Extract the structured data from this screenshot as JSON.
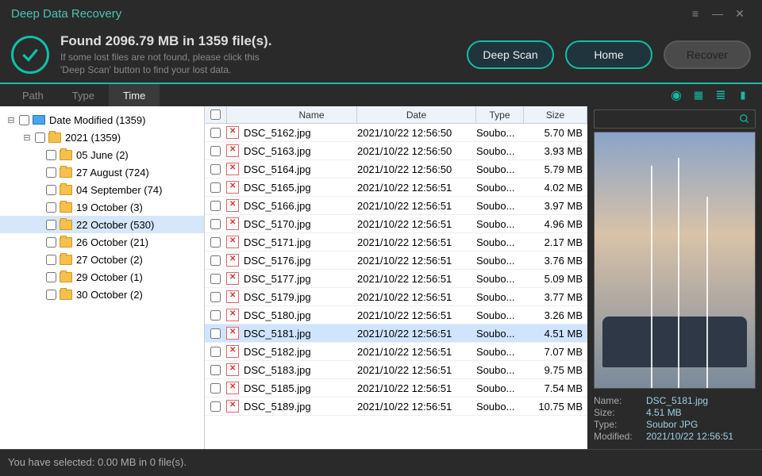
{
  "window": {
    "title": "Deep Data Recovery"
  },
  "header": {
    "found_line": "Found 2096.79 MB in 1359 file(s).",
    "hint_l1": "If some lost files are not found, please click this",
    "hint_l2": "'Deep Scan' button to find your lost data.",
    "btn_deep_scan": "Deep Scan",
    "btn_home": "Home",
    "btn_recover": "Recover"
  },
  "tabs": {
    "path": "Path",
    "type": "Type",
    "time": "Time"
  },
  "tree": {
    "root": "Date Modified (1359)",
    "y2021": "2021 (1359)",
    "nodes": [
      "05 June (2)",
      "27 August (724)",
      "04 September (74)",
      "19 October (3)",
      "22 October (530)",
      "26 October (21)",
      "27 October (2)",
      "29 October (1)",
      "30 October (2)"
    ]
  },
  "columns": {
    "name": "Name",
    "date": "Date",
    "type": "Type",
    "size": "Size"
  },
  "rows": [
    {
      "name": "DSC_5162.jpg",
      "date": "2021/10/22 12:56:50",
      "type": "Soubo...",
      "size": "5.70 MB"
    },
    {
      "name": "DSC_5163.jpg",
      "date": "2021/10/22 12:56:50",
      "type": "Soubo...",
      "size": "3.93 MB"
    },
    {
      "name": "DSC_5164.jpg",
      "date": "2021/10/22 12:56:50",
      "type": "Soubo...",
      "size": "5.79 MB"
    },
    {
      "name": "DSC_5165.jpg",
      "date": "2021/10/22 12:56:51",
      "type": "Soubo...",
      "size": "4.02 MB"
    },
    {
      "name": "DSC_5166.jpg",
      "date": "2021/10/22 12:56:51",
      "type": "Soubo...",
      "size": "3.97 MB"
    },
    {
      "name": "DSC_5170.jpg",
      "date": "2021/10/22 12:56:51",
      "type": "Soubo...",
      "size": "4.96 MB"
    },
    {
      "name": "DSC_5171.jpg",
      "date": "2021/10/22 12:56:51",
      "type": "Soubo...",
      "size": "2.17 MB"
    },
    {
      "name": "DSC_5176.jpg",
      "date": "2021/10/22 12:56:51",
      "type": "Soubo...",
      "size": "3.76 MB"
    },
    {
      "name": "DSC_5177.jpg",
      "date": "2021/10/22 12:56:51",
      "type": "Soubo...",
      "size": "5.09 MB"
    },
    {
      "name": "DSC_5179.jpg",
      "date": "2021/10/22 12:56:51",
      "type": "Soubo...",
      "size": "3.77 MB"
    },
    {
      "name": "DSC_5180.jpg",
      "date": "2021/10/22 12:56:51",
      "type": "Soubo...",
      "size": "3.26 MB"
    },
    {
      "name": "DSC_5181.jpg",
      "date": "2021/10/22 12:56:51",
      "type": "Soubo...",
      "size": "4.51 MB",
      "selected": true
    },
    {
      "name": "DSC_5182.jpg",
      "date": "2021/10/22 12:56:51",
      "type": "Soubo...",
      "size": "7.07 MB"
    },
    {
      "name": "DSC_5183.jpg",
      "date": "2021/10/22 12:56:51",
      "type": "Soubo...",
      "size": "9.75 MB"
    },
    {
      "name": "DSC_5185.jpg",
      "date": "2021/10/22 12:56:51",
      "type": "Soubo...",
      "size": "7.54 MB"
    },
    {
      "name": "DSC_5189.jpg",
      "date": "2021/10/22 12:56:51",
      "type": "Soubo...",
      "size": "10.75 MB"
    }
  ],
  "preview": {
    "name_label": "Name:",
    "name": "DSC_5181.jpg",
    "size_label": "Size:",
    "size": "4.51 MB",
    "type_label": "Type:",
    "type": "Soubor JPG",
    "mod_label": "Modified:",
    "modified": "2021/10/22 12:56:51"
  },
  "status": "You have selected: 0.00 MB in 0 file(s)."
}
